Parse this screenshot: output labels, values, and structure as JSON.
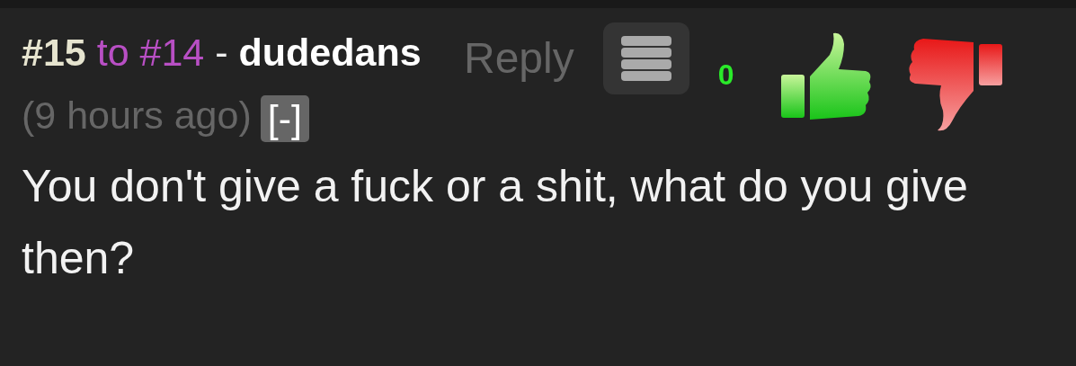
{
  "comment": {
    "number": "#15",
    "reply_to": "to #14",
    "separator": "-",
    "author": "dudedans",
    "time": "(9 hours ago)",
    "collapse": "[-]",
    "reply": "Reply",
    "score": "0",
    "body": "You don't give a fuck or a shit, what do you give then?"
  }
}
